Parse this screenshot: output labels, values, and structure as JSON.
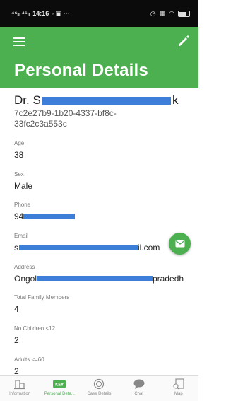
{
  "status_bar": {
    "time": "14:16",
    "signal": "⁴⁶ᵢₗ ⁴⁶ᵢₗ"
  },
  "header": {
    "title": "Personal Details"
  },
  "profile": {
    "name_prefix": "Dr. S",
    "name_suffix": "k",
    "id": "7c2e27b9-1b20-4337-bf8c-33fc2c3a553c"
  },
  "fields": {
    "age": {
      "label": "Age",
      "value": "38"
    },
    "sex": {
      "label": "Sex",
      "value": "Male"
    },
    "phone": {
      "label": "Phone",
      "value": "94"
    },
    "email": {
      "label": "Email",
      "value_start": "s",
      "value_end": "il.com"
    },
    "address": {
      "label": "Address",
      "value_start": "Ongol",
      "value_end": "pradedh"
    },
    "family": {
      "label": "Total Family Members",
      "value": "4"
    },
    "children": {
      "label": "No Children <12",
      "value": "2"
    },
    "adults": {
      "label": "Adults <=60",
      "value": "2"
    }
  },
  "nav": {
    "items": [
      {
        "label": "Information",
        "icon": "building-icon"
      },
      {
        "label": "Personal Deta...",
        "icon": "key-icon"
      },
      {
        "label": "Case Details",
        "icon": "badge-icon"
      },
      {
        "label": "Chat",
        "icon": "chat-icon"
      },
      {
        "label": "Map",
        "icon": "map-icon"
      }
    ]
  },
  "colors": {
    "primary": "#4CAF50",
    "redaction": "#3d7fd8"
  }
}
